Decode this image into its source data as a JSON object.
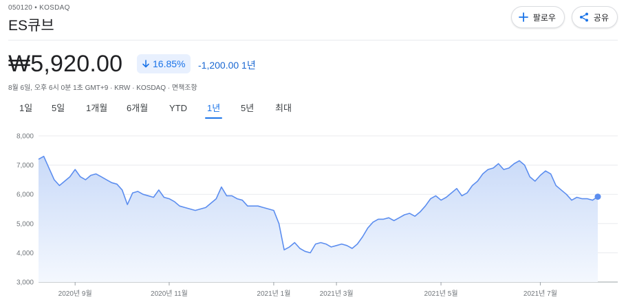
{
  "header": {
    "ticker_line": "050120 • KOSDAQ",
    "company_name": "ES큐브",
    "follow_label": "팔로우",
    "share_label": "공유"
  },
  "quote": {
    "price": "₩5,920.00",
    "percent_change": "16.85%",
    "direction": "down",
    "abs_change": "-1,200.00 1년",
    "meta": "8월 6일, 오후 6시 0분 1초 GMT+9 · KRW · KOSDAQ · 면책조항"
  },
  "tabs": [
    {
      "label": "1일",
      "active": false
    },
    {
      "label": "5일",
      "active": false
    },
    {
      "label": "1개월",
      "active": false
    },
    {
      "label": "6개월",
      "active": false
    },
    {
      "label": "YTD",
      "active": false
    },
    {
      "label": "1년",
      "active": true
    },
    {
      "label": "5년",
      "active": false
    },
    {
      "label": "최대",
      "active": false
    }
  ],
  "colors": {
    "line": "#5b8def",
    "fill_top": "#c9daf8",
    "fill_bottom": "#f4f8fe",
    "down_chip_bg": "#e8f0fe",
    "down_text": "#1a73e8",
    "grid": "#e8eaed"
  },
  "chart_data": {
    "type": "area",
    "ylim": [
      3000,
      8000
    ],
    "y_ticks": [
      "8,000",
      "7,000",
      "6,000",
      "5,000",
      "4,000",
      "3,000"
    ],
    "x_ticks": [
      {
        "label": "2020년 9월",
        "index": 7
      },
      {
        "label": "2020년 11월",
        "index": 25
      },
      {
        "label": "2021년 1월",
        "index": 45
      },
      {
        "label": "2021년 3월",
        "index": 57
      },
      {
        "label": "2021년 5월",
        "index": 77
      },
      {
        "label": "2021년 7월",
        "index": 96
      }
    ],
    "x_count": 108,
    "values": [
      7200,
      7300,
      6900,
      6500,
      6300,
      6450,
      6600,
      6850,
      6600,
      6500,
      6650,
      6700,
      6600,
      6500,
      6400,
      6350,
      6150,
      5650,
      6050,
      6100,
      6000,
      5950,
      5900,
      6150,
      5900,
      5850,
      5750,
      5600,
      5550,
      5500,
      5450,
      5500,
      5550,
      5700,
      5850,
      6250,
      5950,
      5950,
      5850,
      5800,
      5600,
      5600,
      5600,
      5550,
      5500,
      5450,
      5000,
      4100,
      4200,
      4350,
      4150,
      4050,
      4000,
      4300,
      4350,
      4300,
      4200,
      4250,
      4300,
      4250,
      4150,
      4300,
      4550,
      4850,
      5050,
      5150,
      5150,
      5200,
      5100,
      5200,
      5300,
      5350,
      5250,
      5400,
      5600,
      5850,
      5950,
      5800,
      5900,
      6050,
      6200,
      5950,
      6050,
      6300,
      6450,
      6700,
      6850,
      6900,
      7050,
      6850,
      6900,
      7050,
      7150,
      7000,
      6600,
      6450,
      6650,
      6800,
      6700,
      6300,
      6150,
      6000,
      5800,
      5900,
      5850,
      5850,
      5800,
      5920
    ]
  }
}
